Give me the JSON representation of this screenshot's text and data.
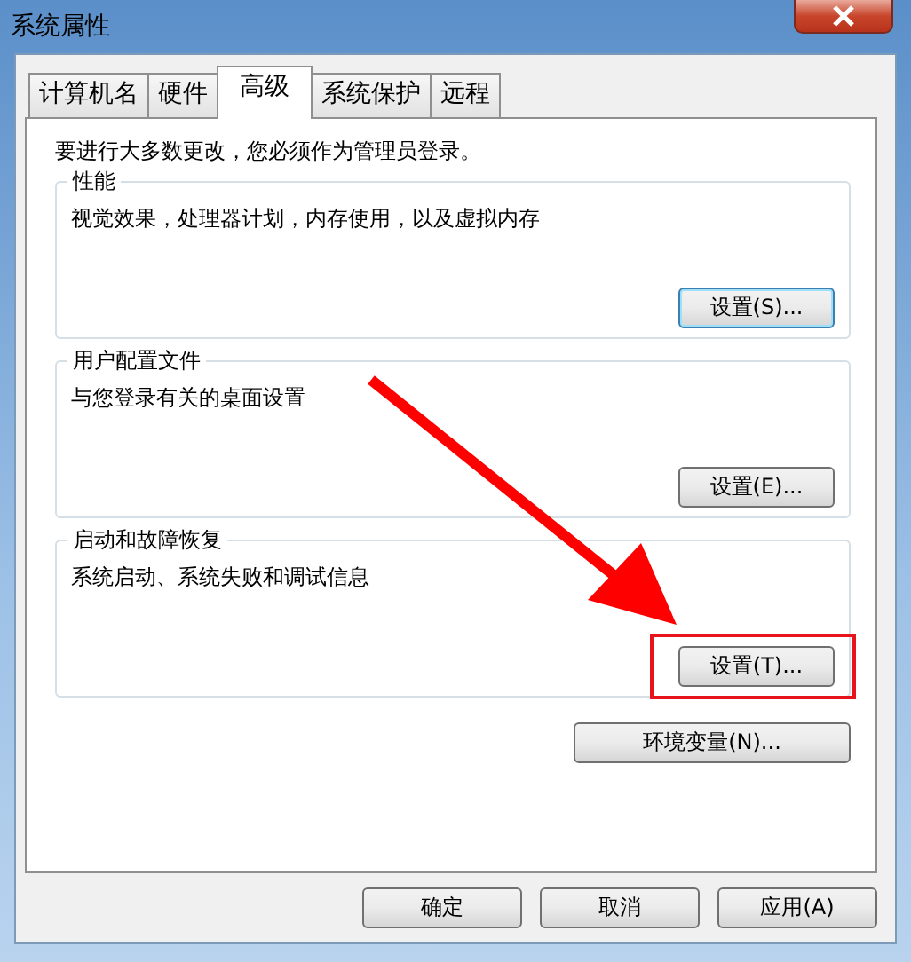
{
  "window": {
    "title": "系统属性"
  },
  "tabs": [
    {
      "label": "计算机名",
      "selected": false
    },
    {
      "label": "硬件",
      "selected": false
    },
    {
      "label": "高级",
      "selected": true
    },
    {
      "label": "系统保护",
      "selected": false
    },
    {
      "label": "远程",
      "selected": false
    }
  ],
  "notice": "要进行大多数更改，您必须作为管理员登录。",
  "groups": [
    {
      "title": "性能",
      "description": "视觉效果，处理器计划，内存使用，以及虚拟内存",
      "button": {
        "label": "设置(S)...",
        "focused": true,
        "highlighted": false
      }
    },
    {
      "title": "用户配置文件",
      "description": "与您登录有关的桌面设置",
      "button": {
        "label": "设置(E)...",
        "focused": false,
        "highlighted": false
      }
    },
    {
      "title": "启动和故障恢复",
      "description": "系统启动、系统失败和调试信息",
      "button": {
        "label": "设置(T)...",
        "focused": false,
        "highlighted": true
      }
    }
  ],
  "env_button": {
    "label": "环境变量(N)..."
  },
  "buttons": [
    {
      "label": "确定"
    },
    {
      "label": "取消"
    },
    {
      "label": "应用(A)"
    }
  ]
}
